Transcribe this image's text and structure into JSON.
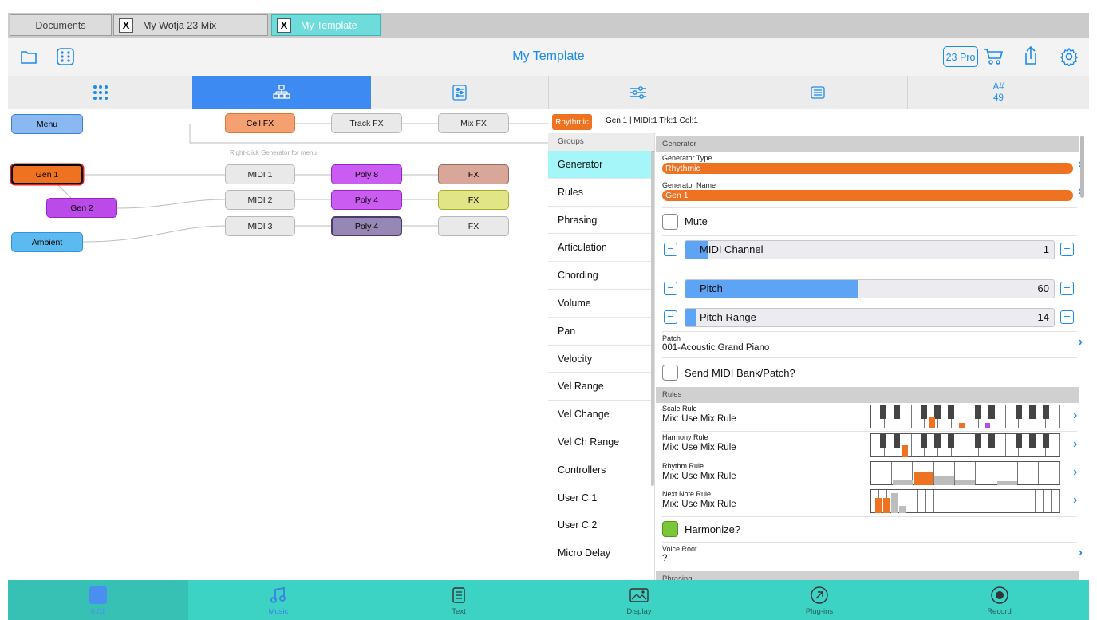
{
  "tabs": {
    "documents": "Documents",
    "mix_close": "X",
    "mix": "My Wotja 23 Mix",
    "template_close": "X",
    "template": "My Template"
  },
  "toolbar": {
    "title": "My Template",
    "pro_badge": "23 Pro"
  },
  "sections": {
    "note_name": "A#",
    "note_value": "49"
  },
  "graph": {
    "hint": "Right-click Generator for menu",
    "menu": "Menu",
    "cell_fx": "Cell FX",
    "track_fx": "Track FX",
    "mix_fx": "Mix FX",
    "generators": [
      "Gen 1",
      "Gen 2",
      "Ambient"
    ],
    "midi": [
      "MIDI 1",
      "MIDI 2",
      "MIDI 3"
    ],
    "poly": [
      "Poly 8",
      "Poly 4",
      "Poly 4"
    ],
    "fx": [
      "FX",
      "FX",
      "FX"
    ]
  },
  "right_header": {
    "badge": "Rhythmic",
    "info": "Gen 1 | MIDI:1 Trk:1 Col:1"
  },
  "groups": {
    "heading": "Groups",
    "items": [
      "Generator",
      "Rules",
      "Phrasing",
      "Articulation",
      "Chording",
      "Volume",
      "Pan",
      "Velocity",
      "Vel Range",
      "Vel Change",
      "Vel Ch Range",
      "Controllers",
      "User C 1",
      "User C 2",
      "Micro Delay"
    ]
  },
  "detail": {
    "section_generator": "Generator",
    "gen_type_label": "Generator Type",
    "gen_type_value": "Rhythmic",
    "gen_name_label": "Generator Name",
    "gen_name_value": "Gen 1",
    "mute": "Mute",
    "midi_channel": {
      "label": "MIDI Channel",
      "value": "1",
      "level": 0.06
    },
    "pitch": {
      "label": "Pitch",
      "value": "60",
      "level": 0.47
    },
    "pitch_range": {
      "label": "Pitch Range",
      "value": "14",
      "level": 0.03
    },
    "patch_label": "Patch",
    "patch_value": "001-Acoustic Grand Piano",
    "send_midi": "Send MIDI Bank/Patch?",
    "section_rules": "Rules",
    "scale_rule_label": "Scale Rule",
    "scale_rule_value": "Mix: Use Mix Rule",
    "harmony_rule_label": "Harmony Rule",
    "harmony_rule_value": "Mix: Use Mix Rule",
    "rhythm_rule_label": "Rhythm Rule",
    "rhythm_rule_value": "Mix: Use Mix Rule",
    "next_note_rule_label": "Next Note Rule",
    "next_note_rule_value": "Mix: Use Mix Rule",
    "harmonize": "Harmonize?",
    "voice_root_label": "Voice Root",
    "voice_root_value": "?",
    "section_phrasing": "Phrasing"
  },
  "bottom": {
    "time": "0:01",
    "music": "Music",
    "text": "Text",
    "display": "Display",
    "plugins": "Plug-ins",
    "record": "Record"
  },
  "colors": {
    "accent_blue": "#1a8bf0",
    "generator_orange": "#ef7220",
    "teal": "#3dd3c4"
  }
}
